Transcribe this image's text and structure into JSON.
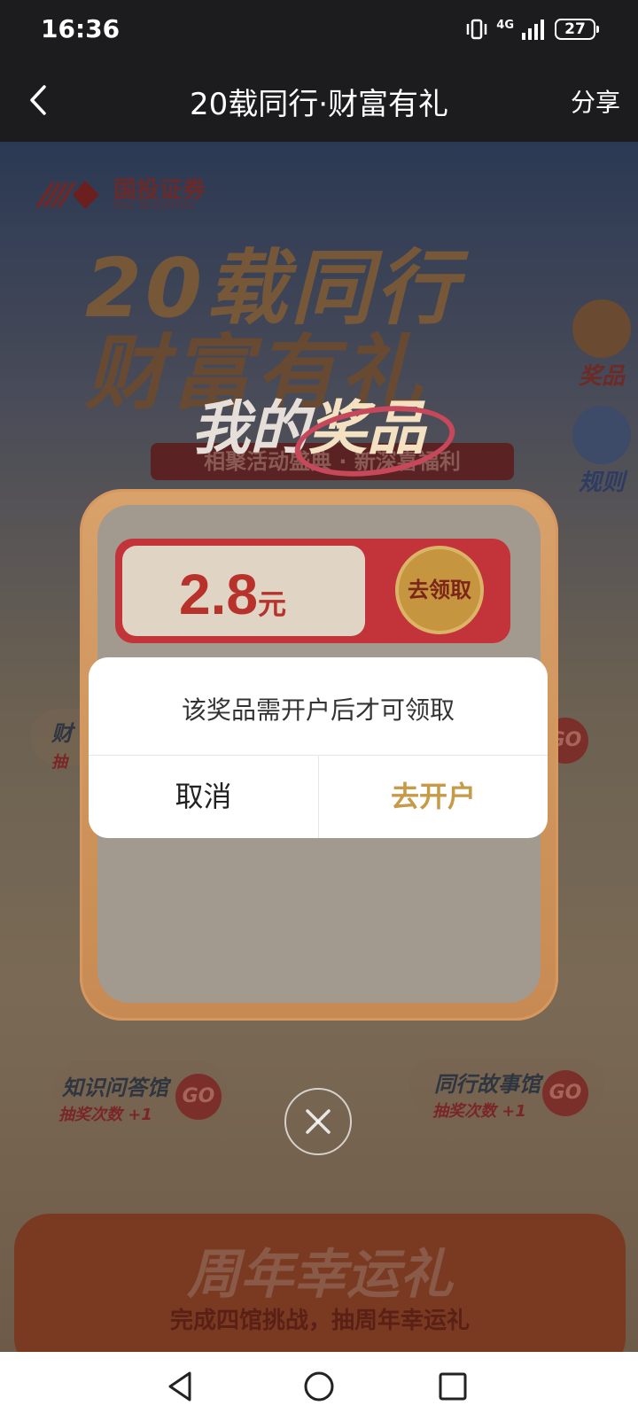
{
  "status_bar": {
    "time": "16:36",
    "network": "4G",
    "battery": "27"
  },
  "title_bar": {
    "title": "20载同行·财富有礼",
    "share_label": "分享"
  },
  "page": {
    "logo_name": "国投证券",
    "logo_sub": "SDIC SECURITIES",
    "hero_line1": "20载同行",
    "hero_line2": "财富有礼",
    "side_prize_label": "奖品",
    "side_rules_label": "规则",
    "promo_sub": "相聚活动盛典 · 新深喜福利",
    "venue_left_title": "财",
    "venue_left_sub": "抽",
    "venue_knowledge_title": "知识问答馆",
    "venue_knowledge_sub": "抽奖次数 +1",
    "venue_story_title": "同行故事馆",
    "venue_story_sub": "抽奖次数 +1",
    "go_label": "GO",
    "bottom_title": "周年幸运礼",
    "bottom_sub": "完成四馆挑战，抽周年幸运礼"
  },
  "prize_modal": {
    "title_part1": "我的",
    "title_part2": "奖品",
    "subtitle": "相聚活动盛典 · 新深喜福利",
    "amount": "2.8",
    "unit": "元",
    "claim_label": "去领取"
  },
  "dialog": {
    "message": "该奖品需开户后才可领取",
    "cancel_label": "取消",
    "confirm_label": "去开户"
  },
  "colors": {
    "accent_gold": "#c79a47",
    "danger_red": "#c2343a"
  }
}
